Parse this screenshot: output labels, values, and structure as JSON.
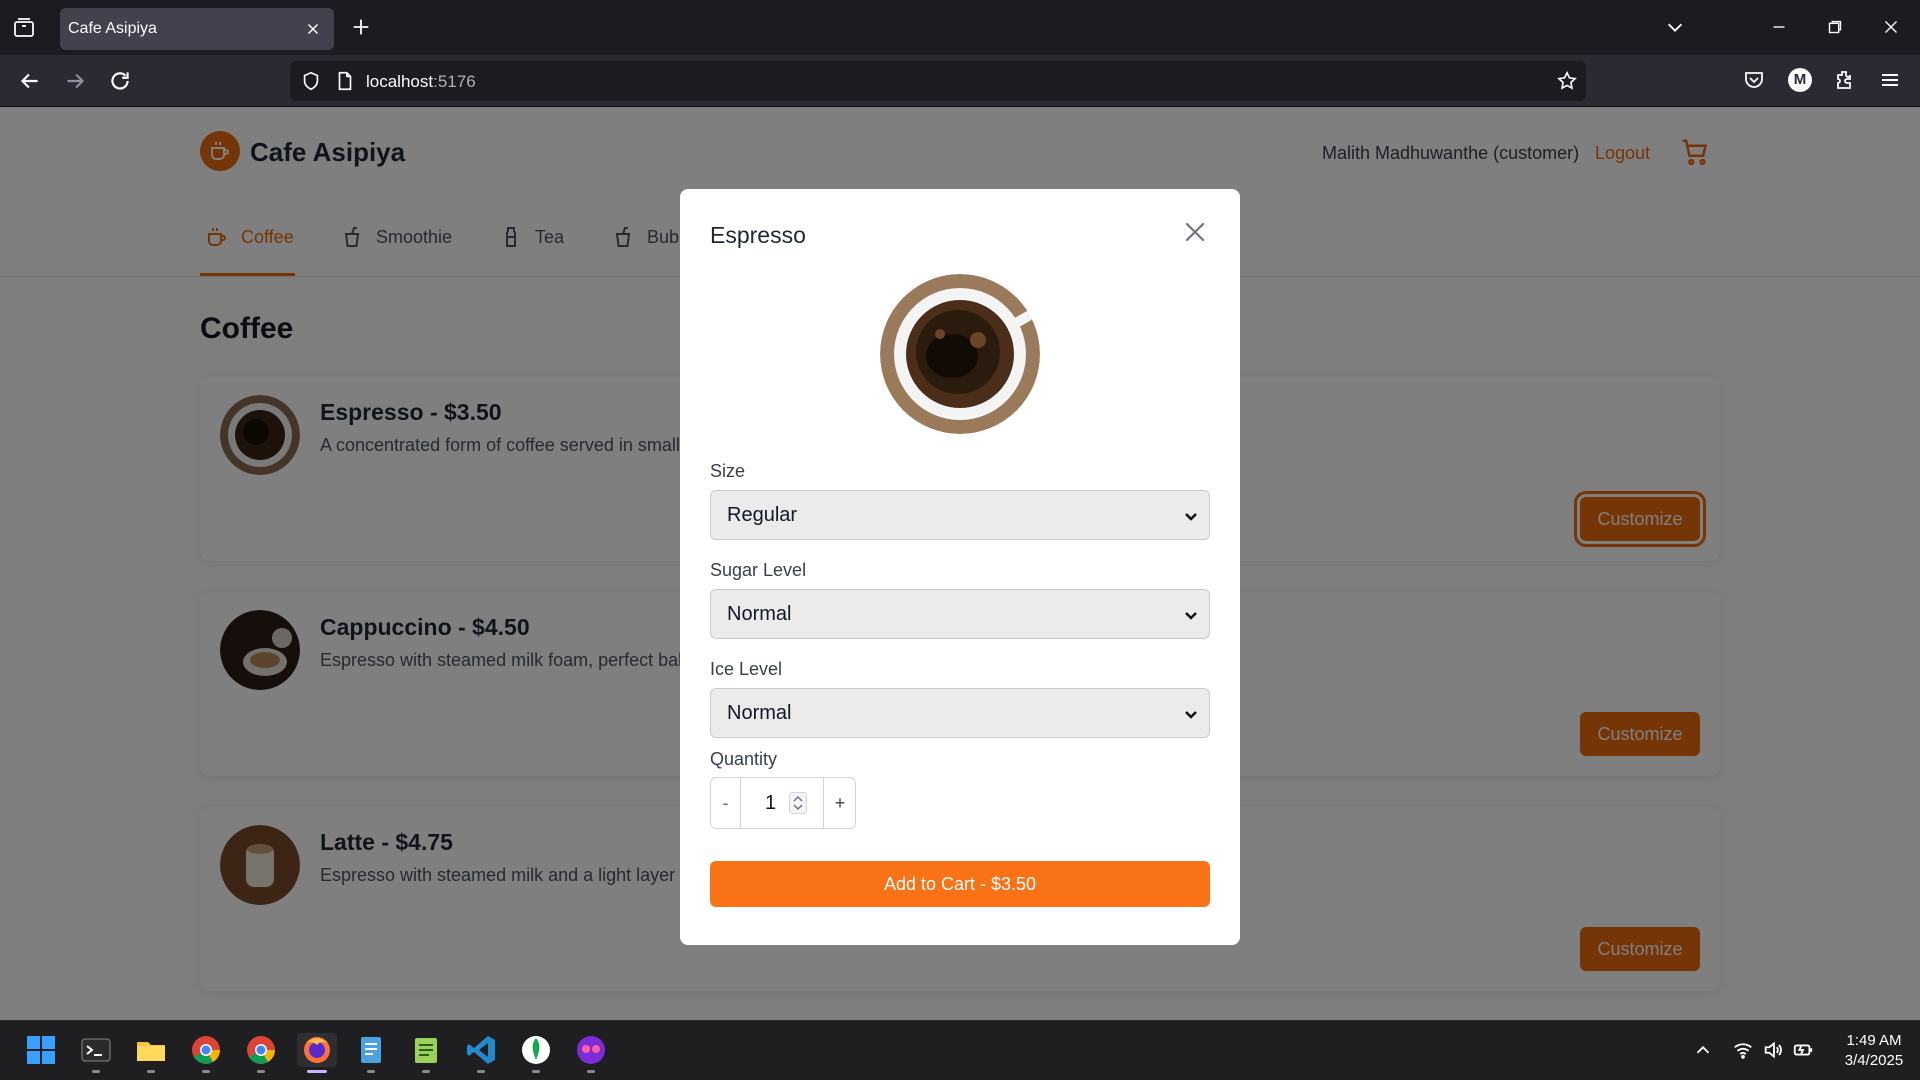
{
  "browser": {
    "tab_title": "Cafe Asipiya",
    "url_host": "localhost",
    "url_port": ":5176"
  },
  "site": {
    "brand": "Cafe Asipiya",
    "user_label": "Malith Madhuwanthe (customer)",
    "logout_label": "Logout",
    "brand_color": "#ea6a0c"
  },
  "categories": [
    {
      "label": "Coffee",
      "icon": "coffee-cup-icon",
      "active": true
    },
    {
      "label": "Smoothie",
      "icon": "smoothie-cup-icon"
    },
    {
      "label": "Tea",
      "icon": "tea-bottle-icon"
    },
    {
      "label": "Bubble Tea",
      "icon": "bubble-tea-icon"
    }
  ],
  "section_title": "Coffee",
  "menu_items": [
    {
      "title": "Espresso - $3.50",
      "description": "A concentrated form of coffee served in small, strong shots.",
      "button": "Customize"
    },
    {
      "title": "Cappuccino - $4.50",
      "description": "Espresso with steamed milk foam, perfect balance of coffee and milk.",
      "button": "Customize"
    },
    {
      "title": "Latte - $4.75",
      "description": "Espresso with steamed milk and a light layer of foam.",
      "button": "Customize"
    }
  ],
  "modal": {
    "title": "Espresso",
    "size_label": "Size",
    "size_value": "Regular",
    "sugar_label": "Sugar Level",
    "sugar_value": "Normal",
    "ice_label": "Ice Level",
    "ice_value": "Normal",
    "quantity_label": "Quantity",
    "quantity_minus": "-",
    "quantity_value": "1",
    "quantity_plus": "+",
    "add_to_cart": "Add to Cart - $3.50",
    "accent_color": "#f97316"
  },
  "taskbar": {
    "time": "1:49 AM",
    "date": "3/4/2025",
    "apps": [
      "windows-start-icon",
      "terminal-icon",
      "file-explorer-icon",
      "chrome-icon",
      "chrome-icon",
      "firefox-icon",
      "notepad-icon",
      "notepad-plus-icon",
      "vscode-icon",
      "mongodb-compass-icon",
      "app-icon"
    ]
  }
}
